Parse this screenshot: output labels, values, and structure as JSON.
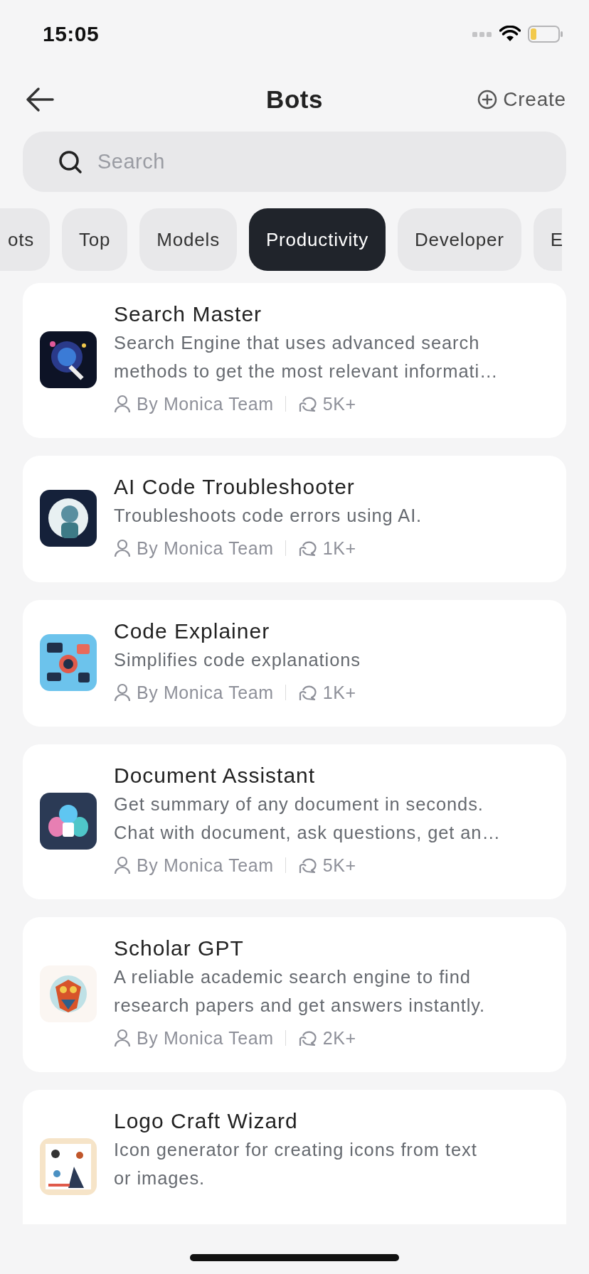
{
  "status_bar": {
    "time": "15:05"
  },
  "header": {
    "title": "Bots",
    "create_label": "Create"
  },
  "search": {
    "placeholder": "Search"
  },
  "categories": [
    {
      "label": "ots",
      "selected": false
    },
    {
      "label": "Top",
      "selected": false
    },
    {
      "label": "Models",
      "selected": false
    },
    {
      "label": "Productivity",
      "selected": true
    },
    {
      "label": "Developer",
      "selected": false
    },
    {
      "label": "E",
      "selected": false
    }
  ],
  "bots": [
    {
      "name": "Search Master",
      "description": [
        "Search Engine that uses advanced search",
        "methods to get the most relevant informati…"
      ],
      "author": "By Monica Team",
      "chats": "5K+"
    },
    {
      "name": "AI Code Troubleshooter",
      "description": [
        "Troubleshoots code errors using AI."
      ],
      "author": "By Monica Team",
      "chats": "1K+"
    },
    {
      "name": "Code Explainer",
      "description": [
        "Simplifies code explanations"
      ],
      "author": "By Monica Team",
      "chats": "1K+"
    },
    {
      "name": "Document Assistant",
      "description": [
        "Get summary of any document in seconds.",
        "Chat with document, ask questions, get an…"
      ],
      "author": "By Monica Team",
      "chats": "5K+"
    },
    {
      "name": "Scholar GPT",
      "description": [
        "A reliable academic search engine to find",
        "research papers and get answers instantly."
      ],
      "author": "By Monica Team",
      "chats": "2K+"
    },
    {
      "name": "Logo Craft Wizard",
      "description": [
        "Icon generator for creating icons from text",
        "or images."
      ]
    }
  ]
}
